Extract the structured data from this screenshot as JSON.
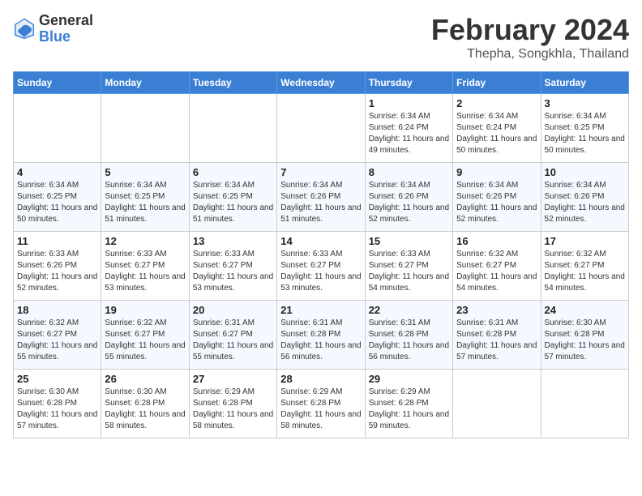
{
  "header": {
    "logo_general": "General",
    "logo_blue": "Blue",
    "month_title": "February 2024",
    "location": "Thepha, Songkhla, Thailand"
  },
  "days_of_week": [
    "Sunday",
    "Monday",
    "Tuesday",
    "Wednesday",
    "Thursday",
    "Friday",
    "Saturday"
  ],
  "weeks": [
    [
      {
        "day": "",
        "sunrise": "",
        "sunset": "",
        "daylight": ""
      },
      {
        "day": "",
        "sunrise": "",
        "sunset": "",
        "daylight": ""
      },
      {
        "day": "",
        "sunrise": "",
        "sunset": "",
        "daylight": ""
      },
      {
        "day": "",
        "sunrise": "",
        "sunset": "",
        "daylight": ""
      },
      {
        "day": "1",
        "sunrise": "Sunrise: 6:34 AM",
        "sunset": "Sunset: 6:24 PM",
        "daylight": "Daylight: 11 hours and 49 minutes."
      },
      {
        "day": "2",
        "sunrise": "Sunrise: 6:34 AM",
        "sunset": "Sunset: 6:24 PM",
        "daylight": "Daylight: 11 hours and 50 minutes."
      },
      {
        "day": "3",
        "sunrise": "Sunrise: 6:34 AM",
        "sunset": "Sunset: 6:25 PM",
        "daylight": "Daylight: 11 hours and 50 minutes."
      }
    ],
    [
      {
        "day": "4",
        "sunrise": "Sunrise: 6:34 AM",
        "sunset": "Sunset: 6:25 PM",
        "daylight": "Daylight: 11 hours and 50 minutes."
      },
      {
        "day": "5",
        "sunrise": "Sunrise: 6:34 AM",
        "sunset": "Sunset: 6:25 PM",
        "daylight": "Daylight: 11 hours and 51 minutes."
      },
      {
        "day": "6",
        "sunrise": "Sunrise: 6:34 AM",
        "sunset": "Sunset: 6:25 PM",
        "daylight": "Daylight: 11 hours and 51 minutes."
      },
      {
        "day": "7",
        "sunrise": "Sunrise: 6:34 AM",
        "sunset": "Sunset: 6:26 PM",
        "daylight": "Daylight: 11 hours and 51 minutes."
      },
      {
        "day": "8",
        "sunrise": "Sunrise: 6:34 AM",
        "sunset": "Sunset: 6:26 PM",
        "daylight": "Daylight: 11 hours and 52 minutes."
      },
      {
        "day": "9",
        "sunrise": "Sunrise: 6:34 AM",
        "sunset": "Sunset: 6:26 PM",
        "daylight": "Daylight: 11 hours and 52 minutes."
      },
      {
        "day": "10",
        "sunrise": "Sunrise: 6:34 AM",
        "sunset": "Sunset: 6:26 PM",
        "daylight": "Daylight: 11 hours and 52 minutes."
      }
    ],
    [
      {
        "day": "11",
        "sunrise": "Sunrise: 6:33 AM",
        "sunset": "Sunset: 6:26 PM",
        "daylight": "Daylight: 11 hours and 52 minutes."
      },
      {
        "day": "12",
        "sunrise": "Sunrise: 6:33 AM",
        "sunset": "Sunset: 6:27 PM",
        "daylight": "Daylight: 11 hours and 53 minutes."
      },
      {
        "day": "13",
        "sunrise": "Sunrise: 6:33 AM",
        "sunset": "Sunset: 6:27 PM",
        "daylight": "Daylight: 11 hours and 53 minutes."
      },
      {
        "day": "14",
        "sunrise": "Sunrise: 6:33 AM",
        "sunset": "Sunset: 6:27 PM",
        "daylight": "Daylight: 11 hours and 53 minutes."
      },
      {
        "day": "15",
        "sunrise": "Sunrise: 6:33 AM",
        "sunset": "Sunset: 6:27 PM",
        "daylight": "Daylight: 11 hours and 54 minutes."
      },
      {
        "day": "16",
        "sunrise": "Sunrise: 6:32 AM",
        "sunset": "Sunset: 6:27 PM",
        "daylight": "Daylight: 11 hours and 54 minutes."
      },
      {
        "day": "17",
        "sunrise": "Sunrise: 6:32 AM",
        "sunset": "Sunset: 6:27 PM",
        "daylight": "Daylight: 11 hours and 54 minutes."
      }
    ],
    [
      {
        "day": "18",
        "sunrise": "Sunrise: 6:32 AM",
        "sunset": "Sunset: 6:27 PM",
        "daylight": "Daylight: 11 hours and 55 minutes."
      },
      {
        "day": "19",
        "sunrise": "Sunrise: 6:32 AM",
        "sunset": "Sunset: 6:27 PM",
        "daylight": "Daylight: 11 hours and 55 minutes."
      },
      {
        "day": "20",
        "sunrise": "Sunrise: 6:31 AM",
        "sunset": "Sunset: 6:27 PM",
        "daylight": "Daylight: 11 hours and 55 minutes."
      },
      {
        "day": "21",
        "sunrise": "Sunrise: 6:31 AM",
        "sunset": "Sunset: 6:28 PM",
        "daylight": "Daylight: 11 hours and 56 minutes."
      },
      {
        "day": "22",
        "sunrise": "Sunrise: 6:31 AM",
        "sunset": "Sunset: 6:28 PM",
        "daylight": "Daylight: 11 hours and 56 minutes."
      },
      {
        "day": "23",
        "sunrise": "Sunrise: 6:31 AM",
        "sunset": "Sunset: 6:28 PM",
        "daylight": "Daylight: 11 hours and 57 minutes."
      },
      {
        "day": "24",
        "sunrise": "Sunrise: 6:30 AM",
        "sunset": "Sunset: 6:28 PM",
        "daylight": "Daylight: 11 hours and 57 minutes."
      }
    ],
    [
      {
        "day": "25",
        "sunrise": "Sunrise: 6:30 AM",
        "sunset": "Sunset: 6:28 PM",
        "daylight": "Daylight: 11 hours and 57 minutes."
      },
      {
        "day": "26",
        "sunrise": "Sunrise: 6:30 AM",
        "sunset": "Sunset: 6:28 PM",
        "daylight": "Daylight: 11 hours and 58 minutes."
      },
      {
        "day": "27",
        "sunrise": "Sunrise: 6:29 AM",
        "sunset": "Sunset: 6:28 PM",
        "daylight": "Daylight: 11 hours and 58 minutes."
      },
      {
        "day": "28",
        "sunrise": "Sunrise: 6:29 AM",
        "sunset": "Sunset: 6:28 PM",
        "daylight": "Daylight: 11 hours and 58 minutes."
      },
      {
        "day": "29",
        "sunrise": "Sunrise: 6:29 AM",
        "sunset": "Sunset: 6:28 PM",
        "daylight": "Daylight: 11 hours and 59 minutes."
      },
      {
        "day": "",
        "sunrise": "",
        "sunset": "",
        "daylight": ""
      },
      {
        "day": "",
        "sunrise": "",
        "sunset": "",
        "daylight": ""
      }
    ]
  ]
}
